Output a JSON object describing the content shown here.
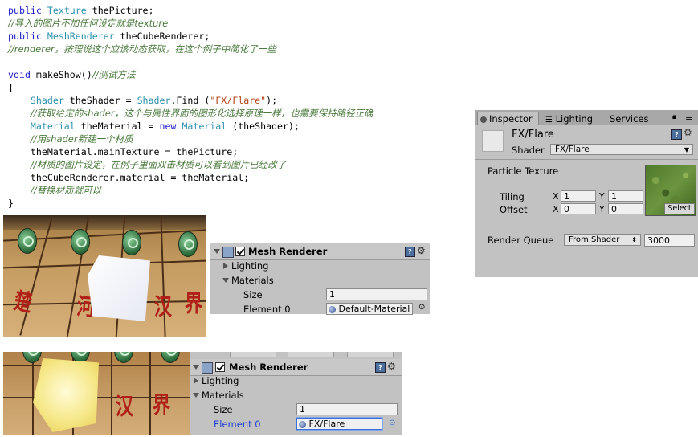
{
  "code": {
    "lines": [
      [
        {
          "t": "public ",
          "c": "kw"
        },
        {
          "t": "Texture",
          "c": "ty"
        },
        {
          "t": " thePicture;",
          "c": ""
        }
      ],
      [
        {
          "t": "//导入的图片不加任何设定就是texture",
          "c": "cm"
        }
      ],
      [
        {
          "t": "public ",
          "c": "kw"
        },
        {
          "t": "MeshRenderer",
          "c": "ty"
        },
        {
          "t": " theCubeRenderer;",
          "c": ""
        }
      ],
      [
        {
          "t": "//renderer，按理说这个应该动态获取，在这个例子中简化了一些",
          "c": "cm"
        }
      ],
      [
        {
          "t": "",
          "c": ""
        }
      ],
      [
        {
          "t": "void ",
          "c": "kw"
        },
        {
          "t": "makeShow()",
          "c": ""
        },
        {
          "t": "//测试方法",
          "c": "cm"
        }
      ],
      [
        {
          "t": "{",
          "c": ""
        }
      ],
      [
        {
          "t": "    ",
          "c": ""
        },
        {
          "t": "Shader",
          "c": "ty"
        },
        {
          "t": " theShader = ",
          "c": ""
        },
        {
          "t": "Shader",
          "c": "ty"
        },
        {
          "t": ".Find (",
          "c": ""
        },
        {
          "t": "\"FX/Flare\"",
          "c": "str"
        },
        {
          "t": ");",
          "c": ""
        }
      ],
      [
        {
          "t": "    ",
          "c": ""
        },
        {
          "t": "//获取给定的shader，这个与属性界面的图形化选择原理一样，也需要保持路径正确",
          "c": "cm"
        }
      ],
      [
        {
          "t": "    ",
          "c": ""
        },
        {
          "t": "Material",
          "c": "ty"
        },
        {
          "t": " theMaterial = ",
          "c": ""
        },
        {
          "t": "new ",
          "c": "kw"
        },
        {
          "t": "Material",
          "c": "ty"
        },
        {
          "t": " (theShader);",
          "c": ""
        }
      ],
      [
        {
          "t": "    ",
          "c": ""
        },
        {
          "t": "//用shader新建一个材质",
          "c": "cm"
        }
      ],
      [
        {
          "t": "    theMaterial.mainTexture = thePicture;",
          "c": ""
        }
      ],
      [
        {
          "t": "    ",
          "c": ""
        },
        {
          "t": "//材质的图片设定，在例子里面双击材质可以看到图片已经改了",
          "c": "cm"
        }
      ],
      [
        {
          "t": "    theCubeRenderer.material = theMaterial;",
          "c": ""
        }
      ],
      [
        {
          "t": "    ",
          "c": ""
        },
        {
          "t": "//替换材质就可以",
          "c": "cm"
        }
      ],
      [
        {
          "t": "}",
          "c": ""
        }
      ]
    ]
  },
  "inspector": {
    "tabs": [
      "Inspector",
      "Lighting",
      "Services"
    ],
    "material_name": "FX/Flare",
    "shader_label": "Shader",
    "shader_value": "FX/Flare",
    "texture_label": "Particle Texture",
    "tiling_label": "Tiling",
    "offset_label": "Offset",
    "x_label": "X",
    "y_label": "Y",
    "tiling_x": "1",
    "tiling_y": "1",
    "offset_x": "0",
    "offset_y": "0",
    "select_label": "Select",
    "render_queue_label": "Render Queue",
    "render_queue_mode": "From Shader",
    "render_queue_value": "3000"
  },
  "mesh_renderer_1": {
    "title": "Mesh Renderer",
    "lighting": "Lighting",
    "materials": "Materials",
    "size_label": "Size",
    "size_value": "1",
    "element_label": "Element 0",
    "element_value": "Default-Material"
  },
  "mesh_renderer_2": {
    "title": "Mesh Renderer",
    "lighting": "Lighting",
    "materials": "Materials",
    "size_label": "Size",
    "size_value": "1",
    "element_label": "Element 0",
    "element_value": "FX/Flare"
  },
  "game_view_1": {
    "board_chars": [
      "楚",
      "河",
      "汉",
      "界"
    ]
  },
  "game_view_2": {
    "board_chars": [
      "汉",
      "界"
    ]
  },
  "colors": {
    "panel_bg": "#c2c2c2",
    "selected_element_label": "#1d3fd6",
    "comment": "#4a7a3c",
    "keyword": "#1a1acc",
    "type": "#2b91af"
  }
}
